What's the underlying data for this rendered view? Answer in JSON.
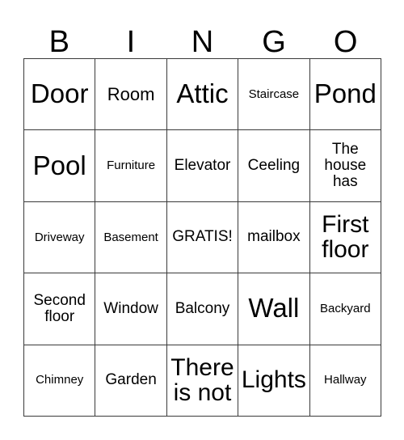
{
  "card": {
    "title": "BINGO Card",
    "background_color": "#ffffff",
    "border_color": "#3a3a3a",
    "text_color": "#000000",
    "header": {
      "letters": [
        "B",
        "I",
        "N",
        "G",
        "O"
      ]
    },
    "grid": {
      "columns": 5,
      "rows": 5,
      "cells": [
        {
          "text": "Door",
          "size": "t-xl",
          "row": 1,
          "col": 1
        },
        {
          "text": "Room",
          "size": "t-md",
          "row": 1,
          "col": 2
        },
        {
          "text": "Attic",
          "size": "t-xl",
          "row": 1,
          "col": 3
        },
        {
          "text": "Staircase",
          "size": "t-xs",
          "row": 1,
          "col": 4
        },
        {
          "text": "Pond",
          "size": "t-xl",
          "row": 1,
          "col": 5
        },
        {
          "text": "Pool",
          "size": "t-xl",
          "row": 2,
          "col": 1
        },
        {
          "text": "Furniture",
          "size": "t-xs",
          "row": 2,
          "col": 2
        },
        {
          "text": "Elevator",
          "size": "t-sm",
          "row": 2,
          "col": 3
        },
        {
          "text": "Ceeling",
          "size": "t-sm",
          "row": 2,
          "col": 4
        },
        {
          "text": "The house has",
          "size": "t-sm",
          "row": 2,
          "col": 5
        },
        {
          "text": "Driveway",
          "size": "t-xs",
          "row": 3,
          "col": 1
        },
        {
          "text": "Basement",
          "size": "t-xs",
          "row": 3,
          "col": 2
        },
        {
          "text": "GRATIS!",
          "size": "t-sm",
          "row": 3,
          "col": 3
        },
        {
          "text": "mailbox",
          "size": "t-sm",
          "row": 3,
          "col": 4
        },
        {
          "text": "First floor",
          "size": "t-lg",
          "row": 3,
          "col": 5
        },
        {
          "text": "Second floor",
          "size": "t-sm",
          "row": 4,
          "col": 1
        },
        {
          "text": "Window",
          "size": "t-sm",
          "row": 4,
          "col": 2
        },
        {
          "text": "Balcony",
          "size": "t-sm",
          "row": 4,
          "col": 3
        },
        {
          "text": "Wall",
          "size": "t-xl",
          "row": 4,
          "col": 4
        },
        {
          "text": "Backyard",
          "size": "t-xs",
          "row": 4,
          "col": 5
        },
        {
          "text": "Chimney",
          "size": "t-xs",
          "row": 5,
          "col": 1
        },
        {
          "text": "Garden",
          "size": "t-sm",
          "row": 5,
          "col": 2
        },
        {
          "text": "There is not",
          "size": "t-lg",
          "row": 5,
          "col": 3
        },
        {
          "text": "Lights",
          "size": "t-lg",
          "row": 5,
          "col": 4
        },
        {
          "text": "Hallway",
          "size": "t-xs",
          "row": 5,
          "col": 5
        }
      ]
    }
  }
}
